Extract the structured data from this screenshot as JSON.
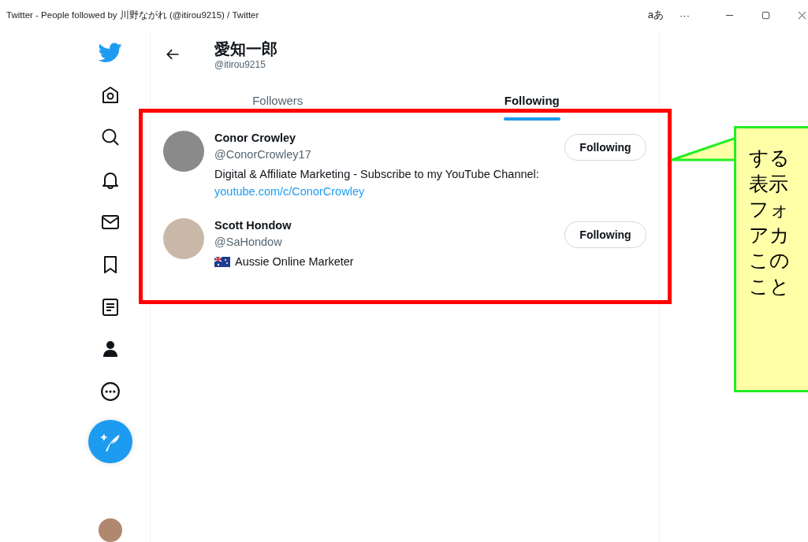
{
  "window": {
    "title": "Twitter - People followed by 川野ながれ (@itirou9215) / Twitter",
    "reader_button": "aあ",
    "more_button": "···"
  },
  "sidebar": {
    "items": [
      {
        "kind": "bird"
      },
      {
        "kind": "home"
      },
      {
        "kind": "search"
      },
      {
        "kind": "bell"
      },
      {
        "kind": "mail"
      },
      {
        "kind": "bookmark"
      },
      {
        "kind": "list"
      },
      {
        "kind": "person"
      },
      {
        "kind": "more"
      }
    ]
  },
  "header": {
    "name": "愛知一郎",
    "handle": "@itirou9215"
  },
  "tabs": [
    {
      "label": "Followers",
      "selected": false
    },
    {
      "label": "Following",
      "selected": true
    }
  ],
  "users": [
    {
      "name": "Conor Crowley",
      "handle": "@ConorCrowley17",
      "bio": "Digital & Affiliate Marketing - Subscribe to my YouTube Channel:",
      "link": "youtube.com/c/ConorCrowley",
      "flag": false,
      "button": "Following"
    },
    {
      "name": "Scott Hondow",
      "handle": "@SaHondow",
      "bio": "Aussie Online Marketer",
      "flag": true,
      "button": "Following"
    }
  ],
  "callout": {
    "lines": [
      "する",
      "表示",
      "フォ",
      "アカ",
      "この",
      "こと"
    ]
  }
}
